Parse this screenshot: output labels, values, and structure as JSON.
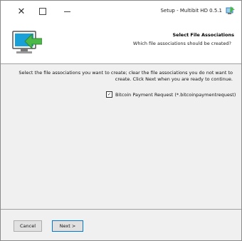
{
  "window": {
    "title": "Setup - Multibit HD 0.5.1",
    "caption_close": "✕"
  },
  "header": {
    "title": "Select File Associations",
    "subtitle": "Which file associations should be created?"
  },
  "content": {
    "instructions": "Select the file associations you want to create; clear the file associations you do not want to create. Click Next when you are ready to continue.",
    "association": {
      "label": "Bitcoin Payment Request (*.bitcoinpaymentrequest)",
      "checked": true,
      "check_glyph": "✓"
    }
  },
  "buttons": {
    "next": "Next >",
    "cancel": "Cancel"
  },
  "colors": {
    "accent": "#0078d7",
    "monitor_screen": "#1aa0d8",
    "arrow_green": "#4cb848"
  }
}
